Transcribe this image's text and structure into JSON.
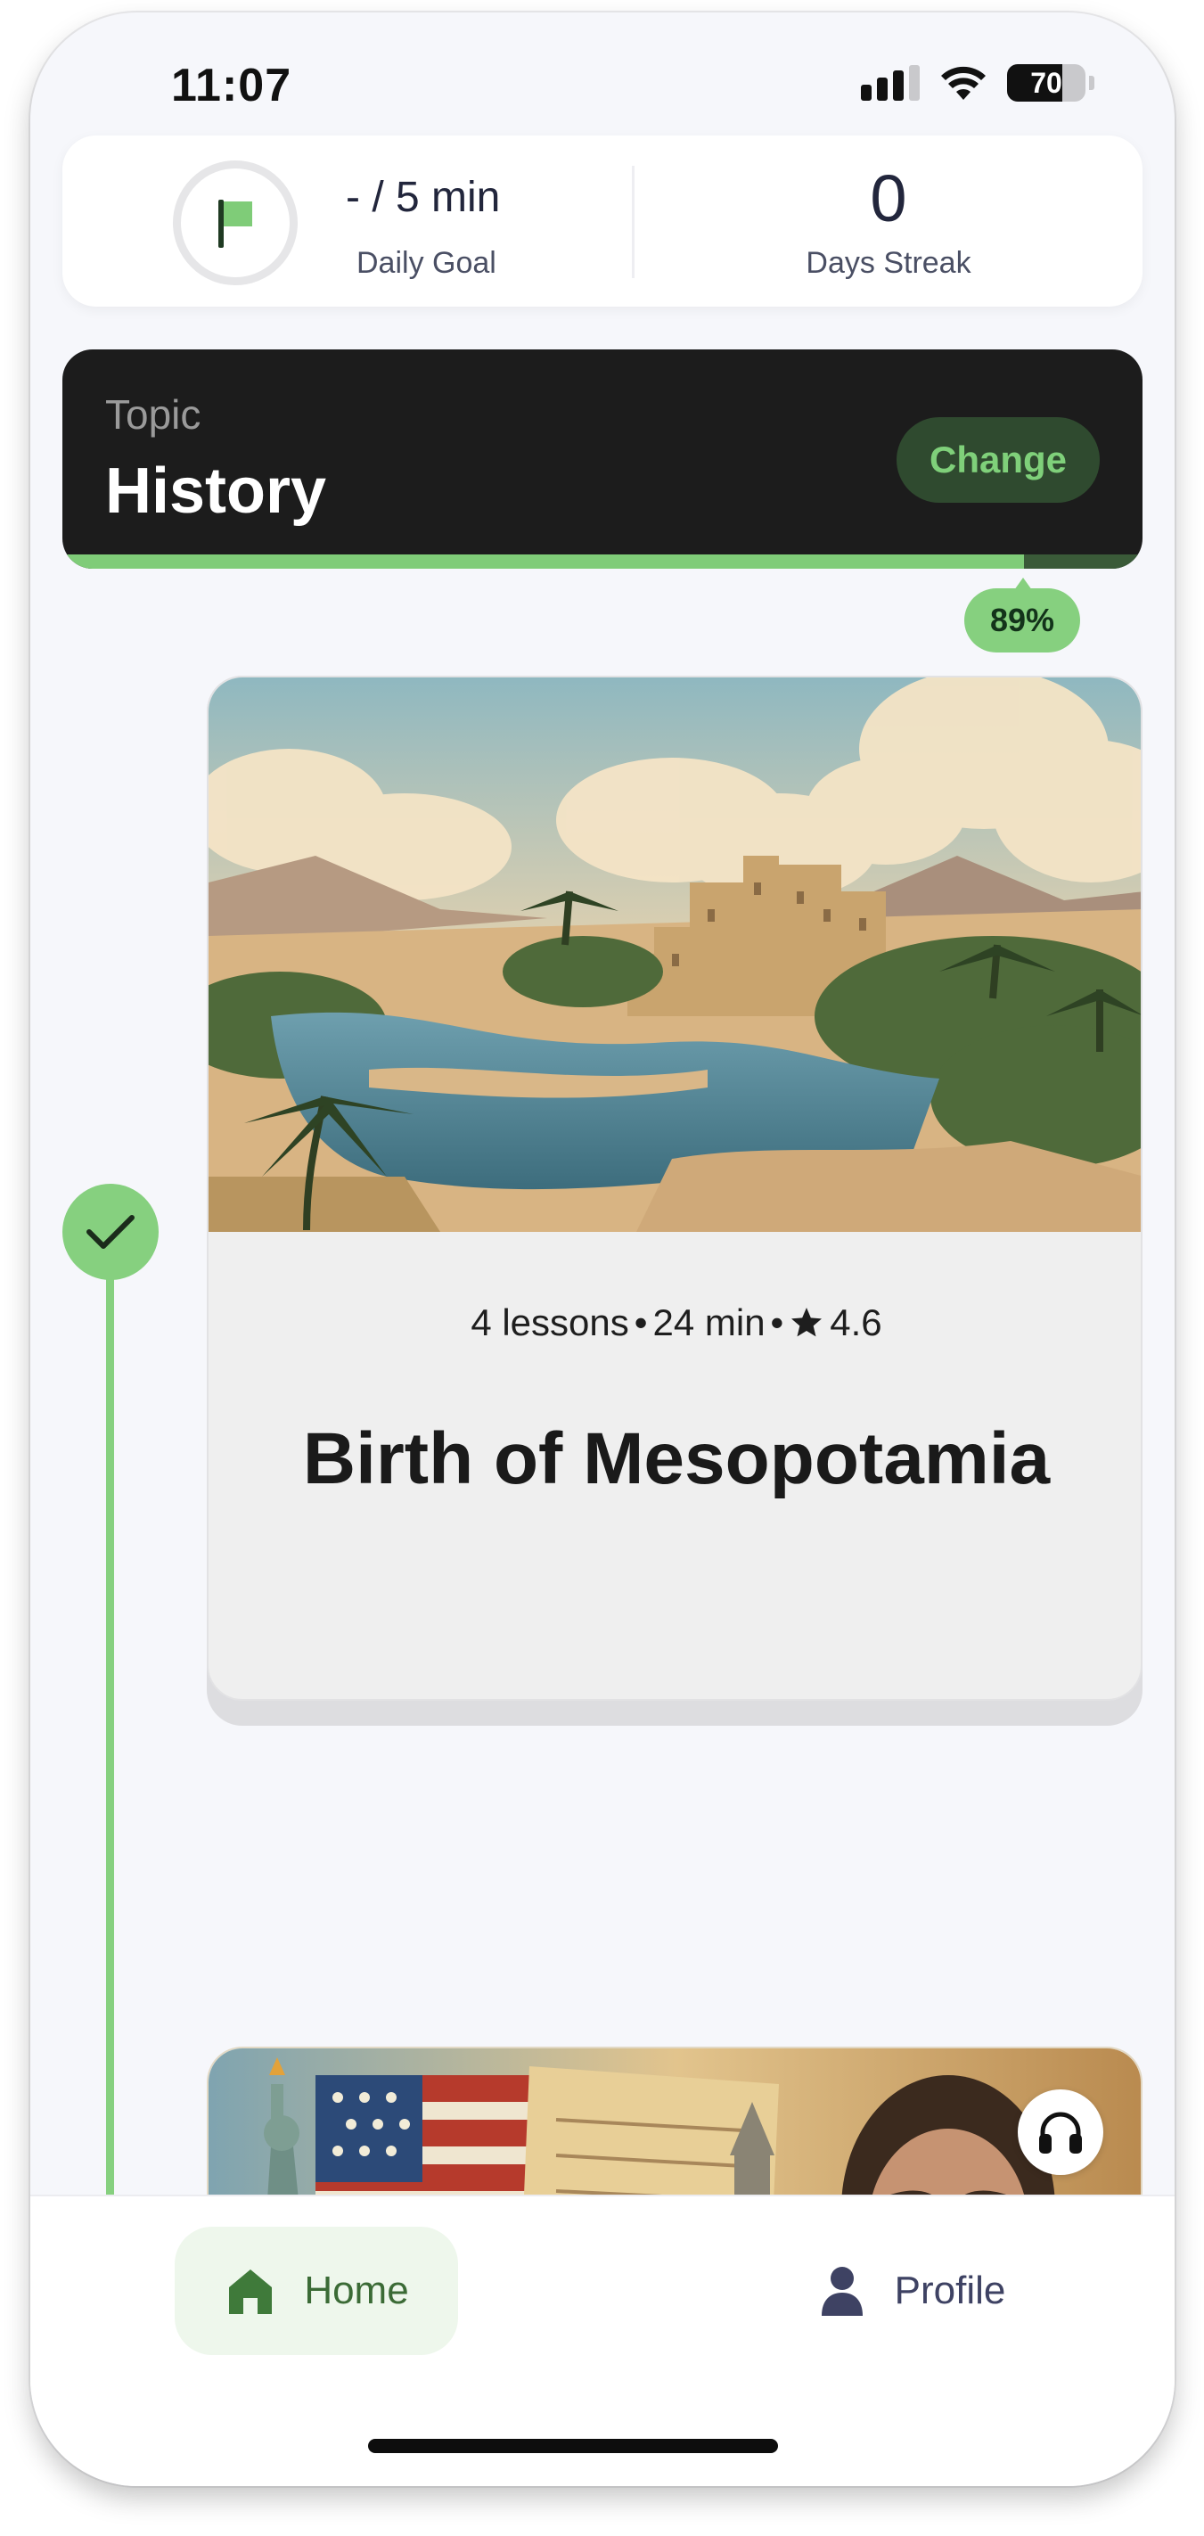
{
  "status_bar": {
    "time": "11:07",
    "battery": "70",
    "icons": [
      "signal-icon",
      "wifi-icon",
      "battery-icon"
    ]
  },
  "goal": {
    "value": "- / 5 min",
    "label": "Daily Goal",
    "icon": "flag-icon"
  },
  "streak": {
    "value": "0",
    "label": "Days Streak"
  },
  "topic": {
    "label": "Topic",
    "title": "History",
    "change_label": "Change",
    "progress_percent": 89,
    "progress_label": "89%"
  },
  "lessons": [
    {
      "lessons_count": "4 lessons",
      "duration": "24 min",
      "rating": "4.6",
      "title": "Birth of Mesopotamia",
      "completed": true,
      "image": "desert-oasis-city-illustration"
    },
    {
      "image": "american-history-illustration",
      "audio_icon": "headphones-icon"
    }
  ],
  "nav": {
    "home_label": "Home",
    "profile_label": "Profile",
    "active": "home"
  },
  "colors": {
    "accent_green": "#86d07f",
    "dark_card": "#1c1c1c",
    "background": "#f6f7fb",
    "text_navy": "#22263c"
  }
}
